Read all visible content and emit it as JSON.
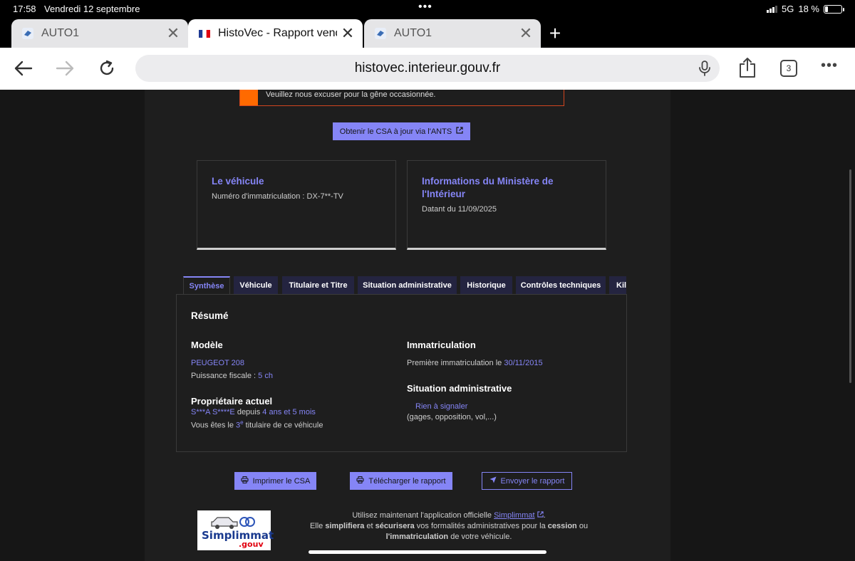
{
  "status_bar": {
    "time": "17:58",
    "date": "Vendredi 12 septembre",
    "network": "5G",
    "battery": "18 %",
    "battery_level": 0.18
  },
  "browser": {
    "tabs": [
      {
        "title": "AUTO1",
        "active": false
      },
      {
        "title": "HistoVec - Rapport vendeur",
        "active": true
      },
      {
        "title": "AUTO1",
        "active": false
      }
    ],
    "url": "histovec.interieur.gouv.fr",
    "tab_count": "3"
  },
  "notice": {
    "text": "Veuillez nous excuser pour la gêne occasionnée."
  },
  "csa_button": {
    "label": "Obtenir le CSA à jour via l'ANTS"
  },
  "cards": {
    "vehicle": {
      "title": "Le véhicule",
      "subtitle": "Numéro d'immatriculation : DX-7**-TV"
    },
    "ministry": {
      "title_line1": "Informations du Ministère de",
      "title_line2": "l'Intérieur",
      "subtitle": "Datant du 11/09/2025"
    }
  },
  "report_tabs": [
    {
      "label": "Synthèse",
      "active": true
    },
    {
      "label": "Véhicule"
    },
    {
      "label": "Titulaire et Titre"
    },
    {
      "label": "Situation administrative"
    },
    {
      "label": "Historique"
    },
    {
      "label": "Contrôles techniques"
    },
    {
      "label": "Kilo"
    }
  ],
  "summary": {
    "title": "Résumé",
    "model": {
      "heading": "Modèle",
      "name": "PEUGEOT 208",
      "power_label": "Puissance fiscale : ",
      "power_value": "5 ch"
    },
    "owner": {
      "heading": "Propriétaire actuel",
      "name": "S***A S****E",
      "since_label": " depuis ",
      "since_value": "4 ans et 5 mois",
      "rank_prefix": "Vous êtes le ",
      "rank_value": "3",
      "rank_sup": "e",
      "rank_suffix": " titulaire de ce véhicule"
    },
    "registration": {
      "heading": "Immatriculation",
      "first_label": "Première immatriculation le ",
      "first_value": "30/11/2015"
    },
    "admin": {
      "heading": "Situation administrative",
      "status": "Rien à signaler",
      "detail": "(gages, opposition, vol,...)"
    }
  },
  "actions": {
    "print": "Imprimer le CSA",
    "download": "Télécharger le rapport",
    "send": "Envoyer le rapport"
  },
  "footer": {
    "logo_text": "Simplimmat",
    "logo_sub": ".gouv",
    "line1_prefix": "Utilisez maintenant l'application officielle ",
    "line1_link": "Simplimmat",
    "line1_suffix": ".",
    "line2_a": "Elle ",
    "line2_b": "simplifiera",
    "line2_c": " et ",
    "line2_d": "sécurisera",
    "line2_e": " vos formalités administratives pour la ",
    "line2_f": "cession",
    "line2_g": " ou",
    "line3_a": "l'immatriculation",
    "line3_b": " de votre véhicule."
  }
}
